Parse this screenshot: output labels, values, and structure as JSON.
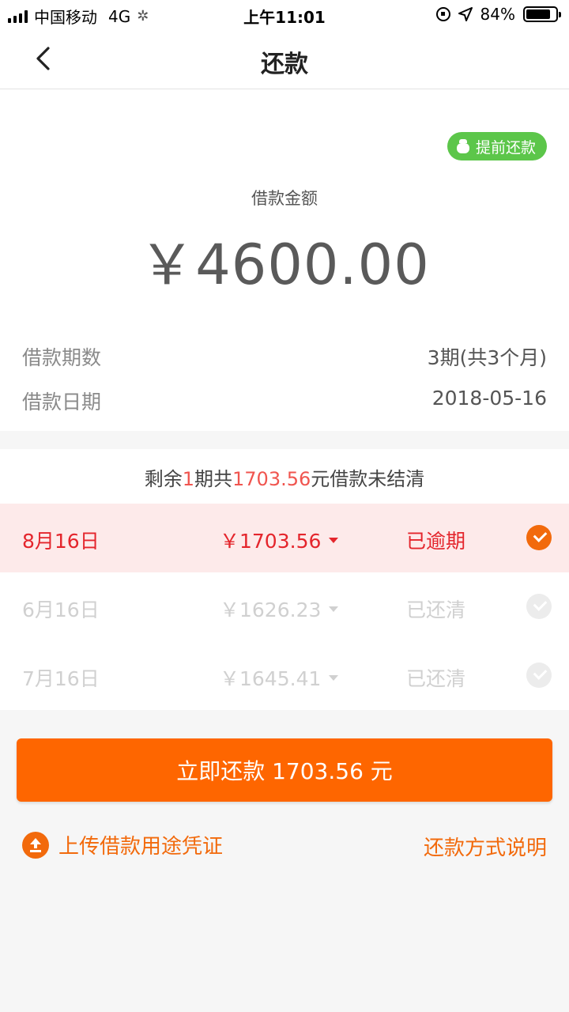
{
  "status_bar": {
    "carrier": "中国移动",
    "network": "4G",
    "time": "上午11:01",
    "battery": "84%",
    "battery_level": 0.84
  },
  "nav": {
    "title": "还款",
    "back_icon": "chevron-left-icon"
  },
  "summary": {
    "prepay_label": "提前还款",
    "amount_label": "借款金额",
    "amount_value": "￥4600.00",
    "periods_label": "借款期数",
    "periods_value": "3期(共3个月)",
    "date_label": "借款日期",
    "date_value": "2018-05-16"
  },
  "remaining": {
    "prefix": "剩余",
    "count": "1",
    "middle": "期共",
    "amount": "1703.56",
    "suffix": "元借款未结清"
  },
  "installments": [
    {
      "date": "8月16日",
      "amount": "￥1703.56",
      "status": "已逾期",
      "selected": true
    },
    {
      "date": "6月16日",
      "amount": "￥1626.23",
      "status": "已还清",
      "selected": false
    },
    {
      "date": "7月16日",
      "amount": "￥1645.41",
      "status": "已还清",
      "selected": false
    }
  ],
  "pay_button": "立即还款 1703.56 元",
  "upload_link": "上传借款用途凭证",
  "method_link": "还款方式说明",
  "colors": {
    "accent": "#fe6600",
    "overdue": "#e4252c",
    "prepay_green": "#5cc64a",
    "highlight": "#f0554f"
  }
}
